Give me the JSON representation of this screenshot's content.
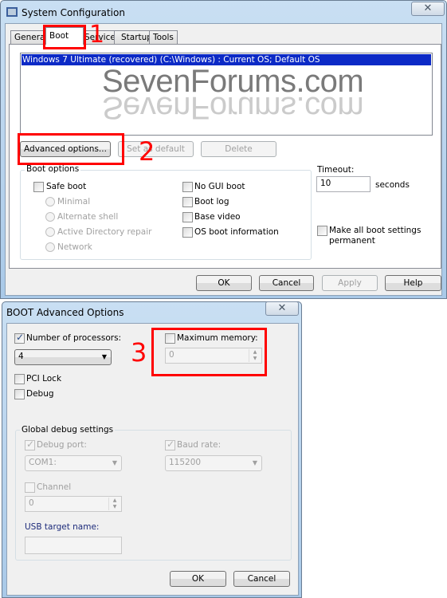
{
  "main_window": {
    "title": "System Configuration",
    "tabs": [
      "General",
      "Boot",
      "Services",
      "Startup",
      "Tools"
    ],
    "active_tab": "Boot",
    "boot_list": [
      "Windows 7 Ultimate (recovered)  (C:\\Windows) : Current OS; Default OS"
    ],
    "watermark": "SevenForums.com",
    "buttons": {
      "advanced": "Advanced options...",
      "set_default": "Set as default",
      "delete": "Delete"
    },
    "boot_options": {
      "label": "Boot options",
      "safe_boot": "Safe boot",
      "minimal": "Minimal",
      "alternate_shell": "Alternate shell",
      "ad_repair": "Active Directory repair",
      "network": "Network",
      "no_gui": "No GUI boot",
      "boot_log": "Boot log",
      "base_video": "Base video",
      "os_boot_info": "OS boot information"
    },
    "timeout": {
      "label": "Timeout:",
      "value": "10",
      "unit": "seconds"
    },
    "permanent_1": "Make all boot settings",
    "permanent_2": "permanent",
    "footer": {
      "ok": "OK",
      "cancel": "Cancel",
      "apply": "Apply",
      "help": "Help"
    }
  },
  "annotations": {
    "one": "1",
    "two": "2",
    "three": "3",
    "color": "#ff0000"
  },
  "adv_window": {
    "title": "BOOT Advanced Options",
    "num_processors": {
      "label": "Number of processors:",
      "checked": true,
      "value": "4"
    },
    "max_memory": {
      "label": "Maximum memory:",
      "checked": false,
      "value": "0"
    },
    "pci_lock": "PCI Lock",
    "debug": "Debug",
    "global_debug": {
      "label": "Global debug settings",
      "debug_port": "Debug port:",
      "port_value": "COM1:",
      "baud_rate": "Baud rate:",
      "baud_value": "115200",
      "channel": "Channel",
      "channel_value": "0",
      "usb_target": "USB target name:",
      "usb_value": ""
    },
    "ok": "OK",
    "cancel": "Cancel"
  },
  "close_glyph": "✕"
}
